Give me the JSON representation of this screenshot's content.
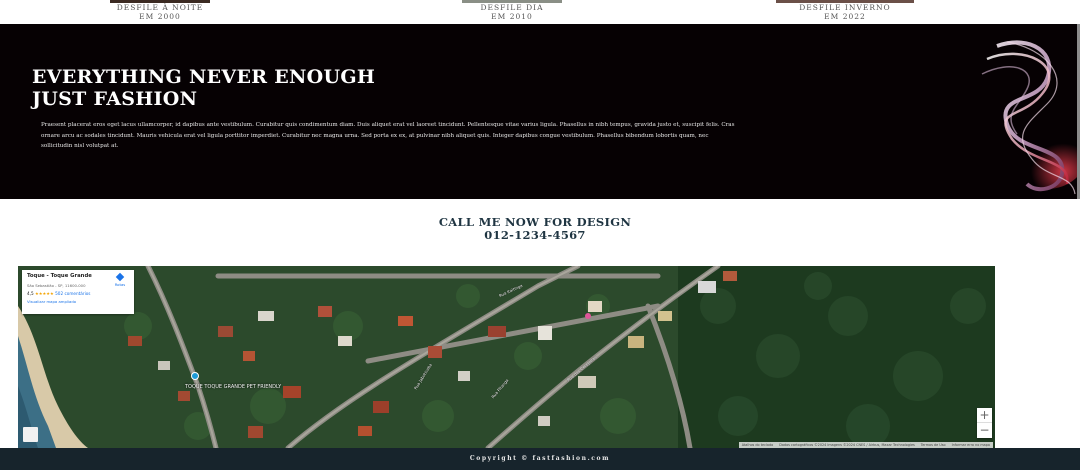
{
  "gallery": {
    "items": [
      {
        "title": "DESFILE À NOITE",
        "year": "EM 2000"
      },
      {
        "title": "DESFILE DIA",
        "year": "EM 2010"
      },
      {
        "title": "DESFILE INVERNO",
        "year": "EM 2022"
      }
    ]
  },
  "banner": {
    "headline_line1": "EVERYTHING NEVER ENOUGH",
    "headline_line2": "JUST FASHION",
    "body": "Praesent placerat eros eget lacus ullamcorper, id dapibus ante vestibulum. Curabitur quis condimentum diam. Duis aliquet erat vel laoreet tincidunt. Pellentesque vitae varius ligula. Phasellus in nibh tempus, gravida justo et, suscipit felis. Cras ornare arcu ac sodales tincidunt. Mauris vehicula erat vel ligula porttitor imperdiet. Curabitur nec magna urna. Sed porta ex ex, at pulvinar nibh aliquet quis. Integer dapibus congue vestibulum. Phasellus bibendum lobortis quam, nec sollicitudin nisl volutpat at."
  },
  "call": {
    "title": "CALL ME NOW FOR DESIGN",
    "phone": "012-1234-4567"
  },
  "map": {
    "place": {
      "name": "Toque - Toque Grande",
      "address": "São Sebastião - SP, 11600-000",
      "rating": "4,5",
      "stars": "★★★★★",
      "reviews": "502 comentários",
      "enlarge_link": "Visualizar mapa ampliado",
      "directions_label": "Rotas"
    },
    "poi_label": "TOQUE TOQUE GRANDE PET FRIENDLY",
    "street_labels": [
      "Rua Jaboticaba",
      "Rua Pitanga",
      "Rua das Cerejeiras",
      "Rua Itaitinga"
    ],
    "zoom_in": "+",
    "zoom_out": "−",
    "footer": [
      "Atalhos do teclado",
      "Dados cartográficos ©2024 Imagens ©2024 CNES / Airbus, Maxar Technologies",
      "Termos de Uso",
      "Informar erro no mapa"
    ]
  },
  "footer": {
    "copyright": "Copyright © fastfashion.com"
  },
  "colors": {
    "banner_bg": "#060103",
    "heading_blue": "#1f3542",
    "footer_bg": "#17242c",
    "link_blue": "#1a73e8"
  }
}
